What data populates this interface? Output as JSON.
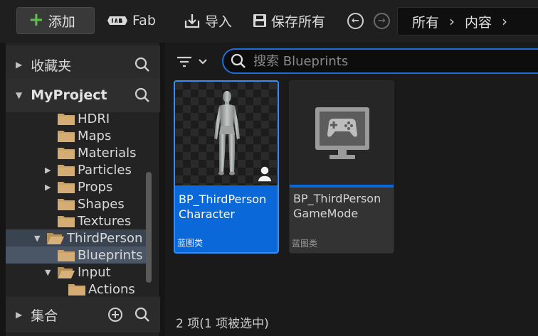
{
  "toolbar": {
    "add_label": "添加",
    "fab_label": "Fab",
    "import_label": "导入",
    "save_all_label": "保存所有",
    "breadcrumb": [
      "所有",
      "内容"
    ]
  },
  "sidebar": {
    "favorites_title": "收藏夹",
    "project_title": "MyProject",
    "collections_title": "集合",
    "tree": [
      {
        "label": "HDRI",
        "expandable": false
      },
      {
        "label": "Maps",
        "expandable": false
      },
      {
        "label": "Materials",
        "expandable": false
      },
      {
        "label": "Particles",
        "expandable": true
      },
      {
        "label": "Props",
        "expandable": true
      },
      {
        "label": "Shapes",
        "expandable": false
      },
      {
        "label": "Textures",
        "expandable": false
      },
      {
        "label": "ThirdPerson",
        "expandable": true,
        "expanded": true
      },
      {
        "label": "Blueprints",
        "expandable": false,
        "selected": true
      },
      {
        "label": "Input",
        "expandable": true,
        "expanded": true
      },
      {
        "label": "Actions",
        "expandable": false
      }
    ]
  },
  "search": {
    "placeholder": "搜索 Blueprints"
  },
  "assets": [
    {
      "name_line1": "BP_ThirdPerson",
      "name_line2": "Character",
      "type": "蓝图类",
      "selected": true
    },
    {
      "name_line1": "BP_ThirdPerson",
      "name_line2": "GameMode",
      "type": "蓝图类",
      "selected": false
    }
  ],
  "status_text": "2 项(1 项被选中)",
  "colors": {
    "accent": "#0a68d8",
    "add_green": "#5fbf4f",
    "folder": "#c9a36b"
  }
}
